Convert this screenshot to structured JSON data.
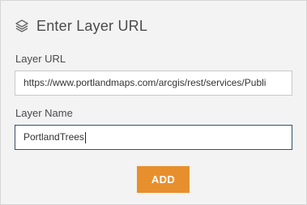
{
  "header": {
    "icon": "layers-icon",
    "title": "Enter Layer URL"
  },
  "form": {
    "url_label": "Layer URL",
    "url_value": "https://www.portlandmaps.com/arcgis/rest/services/Publi",
    "name_label": "Layer Name",
    "name_value": "PortlandTrees"
  },
  "actions": {
    "add_label": "ADD"
  },
  "colors": {
    "accent": "#e88f2d",
    "focus_border": "#36506b",
    "background": "#f3f3f3"
  }
}
